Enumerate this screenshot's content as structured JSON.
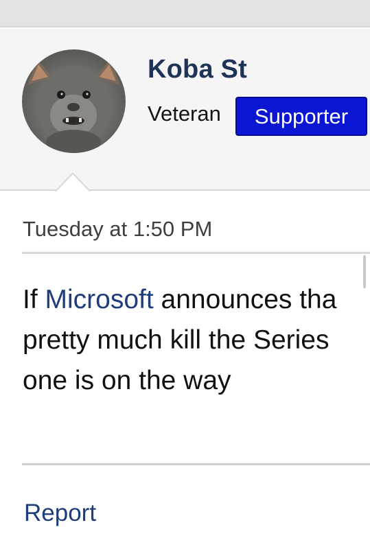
{
  "user": {
    "name": "Koba St",
    "title": "Veteran",
    "badge": "Supporter",
    "badge_color": "#0a16d2",
    "avatar_icon": "bat-photo-avatar"
  },
  "post": {
    "date": "Tuesday at 1:50 PM",
    "body": {
      "line1_prefix": "If ",
      "link_text": "Microsoft",
      "line1_suffix": " announces tha",
      "line2": "pretty much kill the Series",
      "line3": "one is on the way"
    },
    "link_color": "#1f3d7a"
  },
  "actions": {
    "report_label": "Report"
  }
}
